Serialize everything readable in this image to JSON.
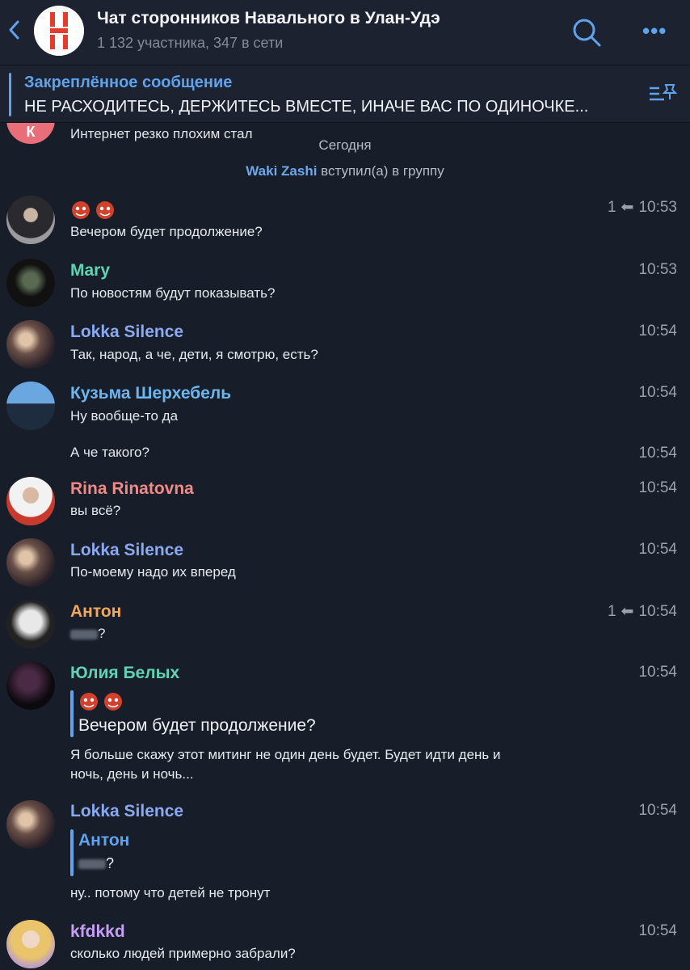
{
  "header": {
    "title": "Чат сторонников Навального в Улан-Удэ",
    "subtitle": "1 132 участника, 347 в сети",
    "more_label": "•••"
  },
  "pinned": {
    "label": "Закреплённое сообщение",
    "text": "НЕ РАСХОДИТЕСЬ, ДЕРЖИТЕСЬ ВМЕСТЕ, ИНАЧЕ ВАС ПО ОДИНОЧКЕ..."
  },
  "prev_message": {
    "avatar_letter": "К",
    "text": "Интернет резко плохим стал"
  },
  "date_divider": "Сегодня",
  "join_event": {
    "user": "Waki Zashi",
    "action": "вступил(а) в группу"
  },
  "messages": [
    {
      "name": "",
      "text": "Вечером будет продолжение?",
      "time": "10:53",
      "replies": "1"
    },
    {
      "name": "Mary",
      "text": "По новостям будут показывать?",
      "time": "10:53"
    },
    {
      "name": "Lokka Silence",
      "text": "Так, народ, а че, дети, я смотрю, есть?",
      "time": "10:54"
    },
    {
      "name": "Кузьма Шерхебель",
      "text": "Ну вообще-то да",
      "time": "10:54"
    },
    {
      "name": "",
      "text": "А че такого?",
      "time": "10:54"
    },
    {
      "name": "Rina Rinatovna",
      "text": "вы всё?",
      "time": "10:54"
    },
    {
      "name": "Lokka Silence",
      "text": "По-моему надо их вперед",
      "time": "10:54"
    },
    {
      "name": "Антон",
      "text": "?",
      "time": "10:54",
      "replies": "1"
    },
    {
      "name": "Юлия Белых",
      "quote": "Вечером будет продолжение?",
      "text_line1": "Я больше скажу этот митинг не один день будет. Будет идти день и",
      "text_line2": "ночь, день и ночь...",
      "time": "10:54"
    },
    {
      "name": "Lokka Silence",
      "quote_author": "Антон",
      "quote": "?",
      "text": "ну.. потому что детей не тронут",
      "time": "10:54"
    },
    {
      "name": "kfdkkd",
      "text": "сколько людей примерно забрали?",
      "time": "10:54"
    }
  ],
  "colors": {
    "background": "#181e29",
    "header": "#1c2230",
    "accent": "#5fa3ec",
    "name_mary": "#5fd3b4",
    "name_lokka": "#8aa9f2",
    "name_kuzma": "#6cb6f0",
    "name_rina": "#ef8a87",
    "name_anton": "#f0a85e",
    "name_yulia": "#5fd3b4",
    "name_kfdkkd": "#c79ef5"
  }
}
